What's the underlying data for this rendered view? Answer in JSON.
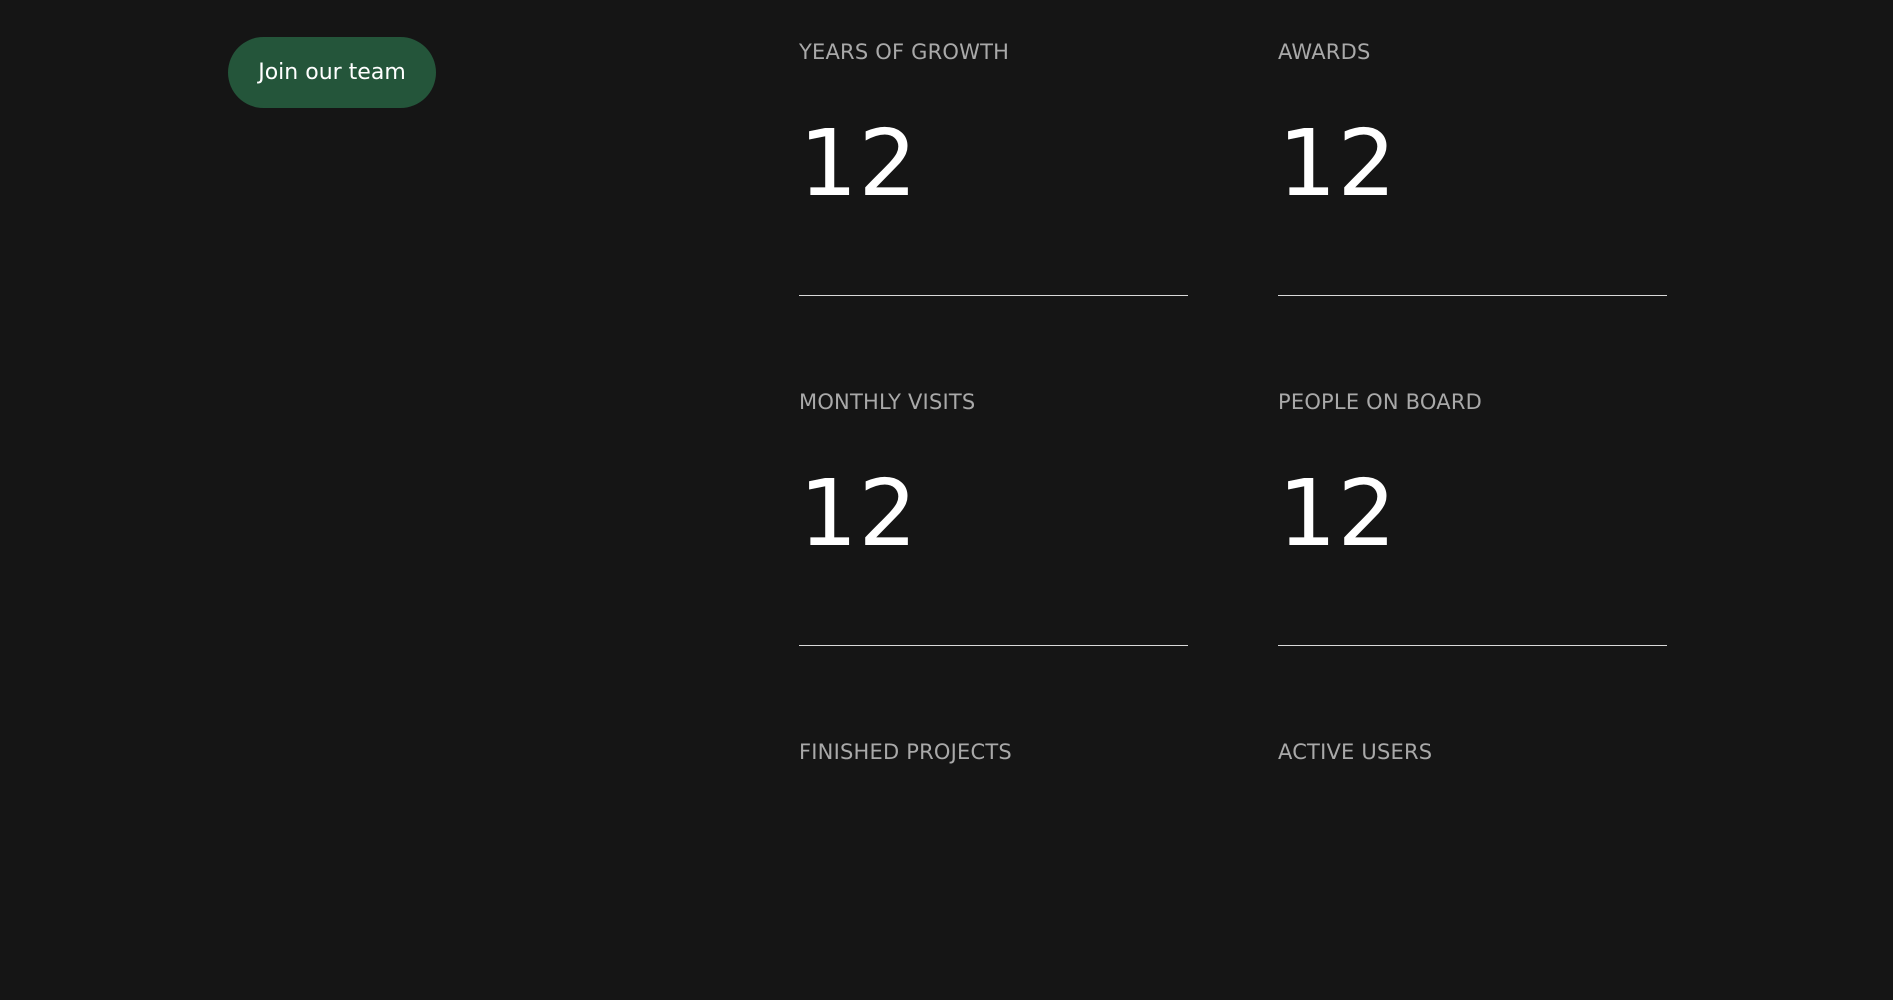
{
  "cta": {
    "label": "Join our team"
  },
  "stats": [
    {
      "label": "YEARS OF GROWTH",
      "value": "12"
    },
    {
      "label": "AWARDS",
      "value": "12"
    },
    {
      "label": "MONTHLY VISITS",
      "value": "12"
    },
    {
      "label": "PEOPLE ON BOARD",
      "value": "12"
    },
    {
      "label": "FINISHED PROJECTS",
      "value": ""
    },
    {
      "label": "ACTIVE USERS",
      "value": ""
    }
  ],
  "colors": {
    "background": "#151515",
    "cta_background": "#24553a",
    "label": "#a9a9a9",
    "value": "#ffffff",
    "divider": "#d9d9d9"
  }
}
